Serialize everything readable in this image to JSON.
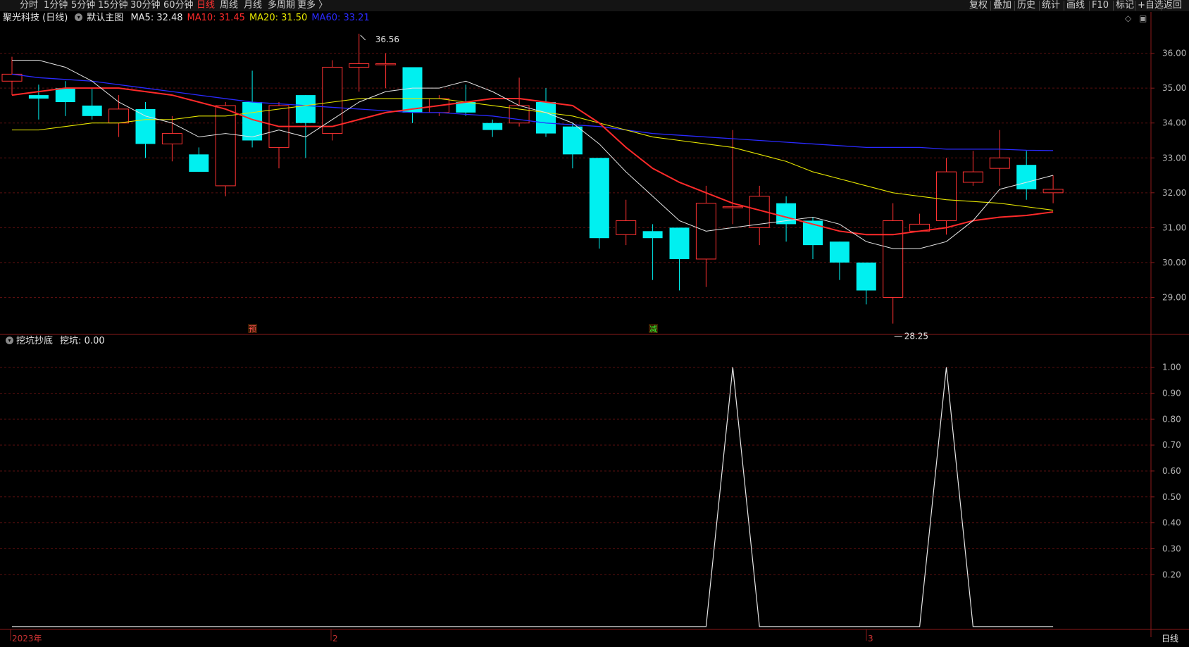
{
  "topbar": {
    "left_items": [
      {
        "label": "分时",
        "active": false
      },
      {
        "label": "1分钟",
        "active": false
      },
      {
        "label": "5分钟",
        "active": false
      },
      {
        "label": "15分钟",
        "active": false
      },
      {
        "label": "30分钟",
        "active": false
      },
      {
        "label": "60分钟",
        "active": false
      },
      {
        "label": "日线",
        "active": true
      },
      {
        "label": "周线",
        "active": false
      },
      {
        "label": "月线",
        "active": false
      },
      {
        "label": "多周期",
        "active": false
      },
      {
        "label": "更多 〉",
        "active": false
      }
    ],
    "right_items": [
      "复权",
      "叠加",
      "历史",
      "统计",
      "画线",
      "F10",
      "标记",
      "+自选",
      "返回"
    ]
  },
  "main_chart": {
    "stock_name": "聚光科技 (日线)",
    "template": "默认主图",
    "ma_labels": [
      {
        "text": "MA5: 32.48",
        "color": "#e6e6e6"
      },
      {
        "text": "MA10: 31.45",
        "color": "#ff2a2a"
      },
      {
        "text": "MA20: 31.50",
        "color": "#e6e600"
      },
      {
        "text": "MA60: 33.21",
        "color": "#2a2aff"
      }
    ],
    "high_label": "36.56",
    "low_label": "28.25",
    "price_ticks": [
      "36.00",
      "35.00",
      "34.00",
      "33.00",
      "32.00",
      "31.00",
      "30.00",
      "29.00"
    ],
    "markers": [
      {
        "text": "预",
        "color": "#ff5050"
      },
      {
        "text": "减",
        "color": "#30ff30"
      }
    ]
  },
  "sub_chart": {
    "title": "挖坑抄底",
    "value_label": "挖坑: 0.00",
    "ticks": [
      "1.00",
      "0.90",
      "0.80",
      "0.70",
      "0.60",
      "0.50",
      "0.40",
      "0.30",
      "0.20"
    ]
  },
  "bottom_axis": {
    "labels": [
      "2023年",
      "2",
      "3"
    ],
    "period_label": "日线"
  },
  "chart_data": {
    "type": "candlestick",
    "candles": [
      {
        "o": 35.2,
        "c": 35.4,
        "h": 35.9,
        "l": 34.8
      },
      {
        "o": 34.8,
        "c": 34.7,
        "h": 35.1,
        "l": 34.1
      },
      {
        "o": 35.0,
        "c": 34.6,
        "h": 35.2,
        "l": 34.2
      },
      {
        "o": 34.5,
        "c": 34.2,
        "h": 35.0,
        "l": 34.1
      },
      {
        "o": 34.0,
        "c": 34.4,
        "h": 34.8,
        "l": 33.6
      },
      {
        "o": 34.4,
        "c": 33.4,
        "h": 34.6,
        "l": 33.0
      },
      {
        "o": 33.4,
        "c": 33.7,
        "h": 34.2,
        "l": 32.9
      },
      {
        "o": 33.1,
        "c": 32.6,
        "h": 33.3,
        "l": 32.6
      },
      {
        "o": 32.2,
        "c": 34.5,
        "h": 34.6,
        "l": 31.9
      },
      {
        "o": 34.6,
        "c": 33.5,
        "h": 35.5,
        "l": 33.3
      },
      {
        "o": 33.3,
        "c": 34.5,
        "h": 34.6,
        "l": 32.7
      },
      {
        "o": 34.8,
        "c": 34.0,
        "h": 34.8,
        "l": 33.0
      },
      {
        "o": 33.7,
        "c": 35.6,
        "h": 35.8,
        "l": 33.5
      },
      {
        "o": 35.6,
        "c": 35.7,
        "h": 36.56,
        "l": 34.9
      },
      {
        "o": 35.7,
        "c": 35.7,
        "h": 36.0,
        "l": 35.0
      },
      {
        "o": 35.6,
        "c": 34.3,
        "h": 35.6,
        "l": 34.0
      },
      {
        "o": 34.3,
        "c": 34.7,
        "h": 34.8,
        "l": 34.2
      },
      {
        "o": 34.6,
        "c": 34.3,
        "h": 35.1,
        "l": 34.2
      },
      {
        "o": 34.0,
        "c": 33.8,
        "h": 34.1,
        "l": 33.6
      },
      {
        "o": 34.0,
        "c": 34.5,
        "h": 35.3,
        "l": 33.9
      },
      {
        "o": 34.6,
        "c": 33.7,
        "h": 35.0,
        "l": 33.6
      },
      {
        "o": 33.9,
        "c": 33.1,
        "h": 34.0,
        "l": 32.7
      },
      {
        "o": 33.0,
        "c": 30.7,
        "h": 33.0,
        "l": 30.4
      },
      {
        "o": 30.8,
        "c": 31.2,
        "h": 31.8,
        "l": 30.5
      },
      {
        "o": 30.9,
        "c": 30.7,
        "h": 31.1,
        "l": 29.5
      },
      {
        "o": 31.0,
        "c": 30.1,
        "h": 31.0,
        "l": 29.2
      },
      {
        "o": 30.1,
        "c": 31.7,
        "h": 32.2,
        "l": 29.3
      },
      {
        "o": 31.6,
        "c": 31.6,
        "h": 33.8,
        "l": 31.1
      },
      {
        "o": 31.0,
        "c": 31.9,
        "h": 32.2,
        "l": 30.5
      },
      {
        "o": 31.7,
        "c": 31.1,
        "h": 31.9,
        "l": 30.6
      },
      {
        "o": 31.2,
        "c": 30.5,
        "h": 31.3,
        "l": 30.1
      },
      {
        "o": 30.6,
        "c": 30.0,
        "h": 30.6,
        "l": 29.5
      },
      {
        "o": 30.0,
        "c": 29.2,
        "h": 30.0,
        "l": 28.8
      },
      {
        "o": 29.0,
        "c": 31.2,
        "h": 31.7,
        "l": 28.25
      },
      {
        "o": 30.9,
        "c": 31.1,
        "h": 31.4,
        "l": 30.9
      },
      {
        "o": 31.2,
        "c": 32.6,
        "h": 33.0,
        "l": 30.8
      },
      {
        "o": 32.3,
        "c": 32.6,
        "h": 33.2,
        "l": 32.2
      },
      {
        "o": 32.7,
        "c": 33.0,
        "h": 33.8,
        "l": 32.2
      },
      {
        "o": 32.8,
        "c": 32.1,
        "h": 33.2,
        "l": 31.8
      },
      {
        "o": 32.0,
        "c": 32.1,
        "h": 32.5,
        "l": 31.7
      }
    ],
    "ma5": [
      35.8,
      35.8,
      35.6,
      35.2,
      34.6,
      34.2,
      34.0,
      33.6,
      33.7,
      33.6,
      33.8,
      33.6,
      34.1,
      34.6,
      34.9,
      35.0,
      35.0,
      35.2,
      34.9,
      34.5,
      34.3,
      34.0,
      33.4,
      32.6,
      31.9,
      31.2,
      30.9,
      31.0,
      31.1,
      31.2,
      31.3,
      31.1,
      30.6,
      30.4,
      30.4,
      30.6,
      31.2,
      32.1,
      32.3,
      32.5
    ],
    "ma10": [
      34.8,
      34.9,
      35.0,
      35.0,
      35.0,
      34.9,
      34.8,
      34.6,
      34.4,
      34.1,
      33.9,
      33.9,
      33.9,
      34.1,
      34.3,
      34.4,
      34.5,
      34.6,
      34.7,
      34.7,
      34.6,
      34.5,
      34.0,
      33.3,
      32.7,
      32.3,
      32.0,
      31.7,
      31.5,
      31.3,
      31.1,
      30.9,
      30.8,
      30.8,
      30.9,
      31.0,
      31.2,
      31.3,
      31.35,
      31.45
    ],
    "ma20": [
      33.8,
      33.8,
      33.9,
      34.0,
      34.0,
      34.1,
      34.1,
      34.2,
      34.2,
      34.3,
      34.4,
      34.5,
      34.6,
      34.7,
      34.7,
      34.7,
      34.7,
      34.6,
      34.5,
      34.4,
      34.3,
      34.2,
      34.0,
      33.8,
      33.6,
      33.5,
      33.4,
      33.3,
      33.1,
      32.9,
      32.6,
      32.4,
      32.2,
      32.0,
      31.9,
      31.8,
      31.75,
      31.7,
      31.6,
      31.5
    ],
    "ma60": [
      35.4,
      35.3,
      35.25,
      35.2,
      35.1,
      35.0,
      34.9,
      34.8,
      34.7,
      34.6,
      34.55,
      34.5,
      34.45,
      34.4,
      34.35,
      34.3,
      34.3,
      34.25,
      34.2,
      34.1,
      34.0,
      33.95,
      33.9,
      33.8,
      33.7,
      33.65,
      33.6,
      33.55,
      33.5,
      33.45,
      33.4,
      33.35,
      33.3,
      33.3,
      33.3,
      33.25,
      33.25,
      33.25,
      33.22,
      33.21
    ],
    "indicator": {
      "name": "挖坑",
      "values": [
        0,
        0,
        0,
        0,
        0,
        0,
        0,
        0,
        0,
        0,
        0,
        0,
        0,
        0,
        0,
        0,
        0,
        0,
        0,
        0,
        0,
        0,
        0,
        0,
        0,
        0,
        0,
        1,
        0,
        0,
        0,
        0,
        0,
        0,
        0,
        1,
        0,
        0,
        0,
        0
      ],
      "ylim": [
        0,
        1
      ]
    },
    "ylim": [
      28.0,
      36.8
    ]
  },
  "colors": {
    "up": "#ff3232",
    "down": "#00f0f0",
    "grid": "#5a0f0f",
    "axis": "#8b1a1a",
    "ma5": "#e6e6e6",
    "ma10": "#ff2a2a",
    "ma20": "#e6e600",
    "ma60": "#2a2aff"
  }
}
